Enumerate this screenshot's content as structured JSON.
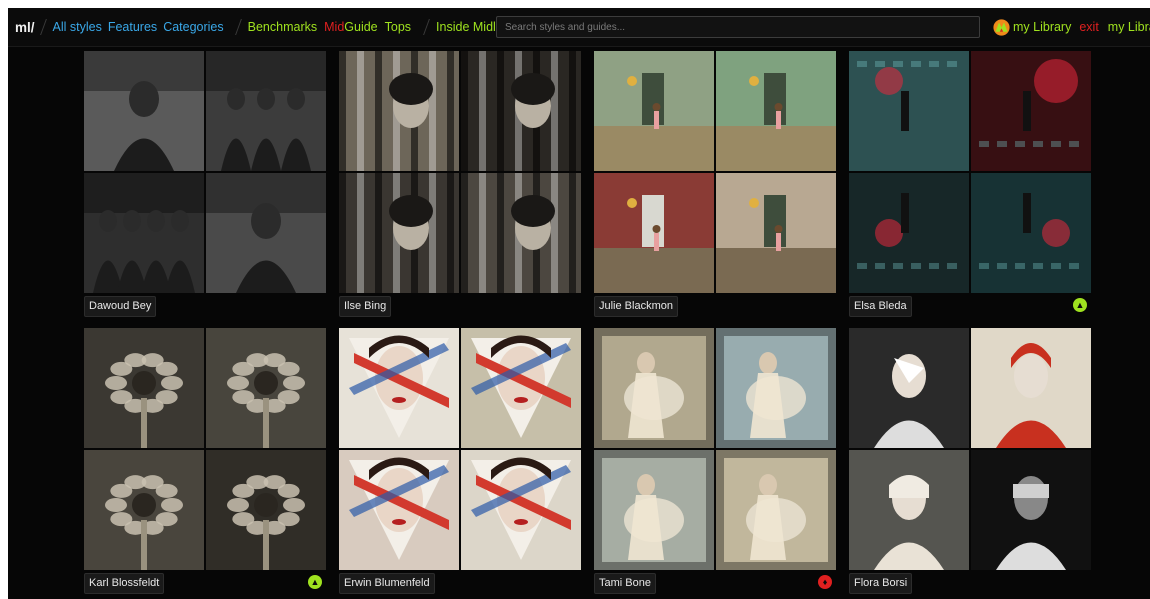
{
  "topbar": {
    "logo": "ml/",
    "nav_blue": [
      "All styles",
      "Features",
      "Categories"
    ],
    "nav_lime": [
      "Benchmarks"
    ],
    "midguide": {
      "part1": "Mid",
      "part2": "Guide"
    },
    "nav_lime2": [
      "Tops",
      "Inside Midlibrary"
    ],
    "search_placeholder": "Search styles and guides...",
    "my_library": "my Library",
    "exit": "exit",
    "my_library_2": "my Library"
  },
  "colors": {
    "accent_green": "#9fe21f",
    "accent_blue": "#3aa8e8",
    "accent_red": "#e02020",
    "background": "#060606"
  },
  "cards": [
    {
      "name": "Dawoud Bey",
      "badge": null,
      "tones": [
        "#5a5a5a",
        "#3c3c3c",
        "#2e2e2e",
        "#4a4a4a"
      ],
      "style": "bw-portrait"
    },
    {
      "name": "Ilse Bing",
      "badge": null,
      "tones": [
        "#6d6659",
        "#2a2723",
        "#3a3631",
        "#4c4740"
      ],
      "style": "bw-curtain"
    },
    {
      "name": "Julie Blackmon",
      "badge": null,
      "tones": [
        "#8fa184",
        "#7fa27f",
        "#8a3b35",
        "#b8a892"
      ],
      "style": "room"
    },
    {
      "name": "Elsa Bleda",
      "badge": "green",
      "badge_icon": "triangle-icon",
      "tones": [
        "#3d6c6e",
        "#4a1518",
        "#1f3436",
        "#1f4346"
      ],
      "style": "neon"
    },
    {
      "name": "Karl Blossfeldt",
      "badge": "green",
      "badge_icon": "triangle-icon",
      "tones": [
        "#5b564d",
        "#6f6a5f",
        "#716b5f",
        "#4b463d"
      ],
      "style": "botanic"
    },
    {
      "name": "Erwin Blumenfeld",
      "badge": null,
      "tones": [
        "#e7e2d8",
        "#c6bfa9",
        "#d8cbbf",
        "#dcd6c9"
      ],
      "style": "fashion"
    },
    {
      "name": "Tami Bone",
      "badge": "red",
      "badge_icon": "flame-icon",
      "tones": [
        "#a79c7f",
        "#8aa1a4",
        "#9aa297",
        "#b9ad8f"
      ],
      "style": "dreamy"
    },
    {
      "name": "Flora Borsi",
      "badge": null,
      "tones": [
        "#2a2a2a",
        "#e0d8c8",
        "#555550",
        "#111111"
      ],
      "style": "surreal"
    }
  ]
}
